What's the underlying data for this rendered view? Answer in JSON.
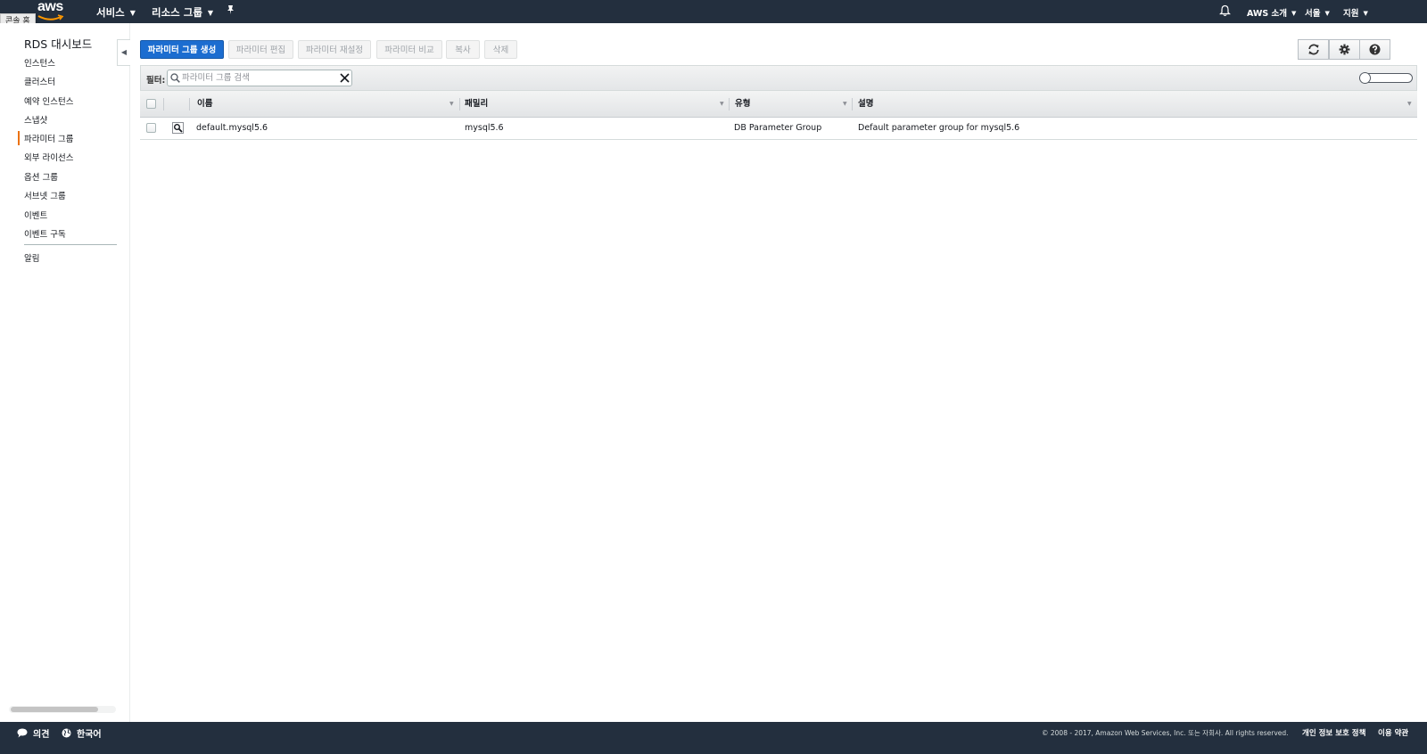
{
  "topnav": {
    "logo_text": "aws",
    "services": "서비스",
    "resource_groups": "리소스 그룹",
    "pin_icon": "pin-icon",
    "bell_icon": "bell-icon",
    "about_aws": "AWS 소개",
    "region": "서울",
    "support": "지원",
    "tooltip": "콘솔 홈"
  },
  "sidebar": {
    "title": "RDS 대시보드",
    "items": [
      {
        "label": "인스턴스"
      },
      {
        "label": "클러스터"
      },
      {
        "label": "예약 인스턴스"
      },
      {
        "label": "스냅샷"
      },
      {
        "label": "파라미터 그룹"
      },
      {
        "label": "외부 라이선스"
      },
      {
        "label": "옵션 그룹"
      },
      {
        "label": "서브넷 그룹"
      },
      {
        "label": "이벤트"
      },
      {
        "label": "이벤트 구독"
      }
    ],
    "active_item": "파라미터 그룹",
    "bottom_item": "알림"
  },
  "toolbar": {
    "create": "파라미터 그룹 생성",
    "edit": "파라미터 편집",
    "reset": "파라미터 재설정",
    "compare": "파라미터 비교",
    "copy": "복사",
    "delete": "삭제"
  },
  "filter": {
    "label": "필터:",
    "placeholder": "파라미터 그룹 검색"
  },
  "table": {
    "columns": [
      "이름",
      "패밀리",
      "유형",
      "설명"
    ],
    "rows": [
      {
        "name": "default.mysql5.6",
        "family": "mysql5.6",
        "type": "DB Parameter Group",
        "description": "Default parameter group for mysql5.6"
      }
    ]
  },
  "footer": {
    "feedback": "의견",
    "language": "한국어",
    "copyright": "© 2008 - 2017, Amazon Web Services, Inc. 또는 자회사. All rights reserved.",
    "privacy": "개인 정보 보호 정책",
    "terms": "이용 약관"
  },
  "colors": {
    "nav_bg": "#232f3e",
    "primary": "#1c6dd0",
    "accent": "#ec7211"
  }
}
